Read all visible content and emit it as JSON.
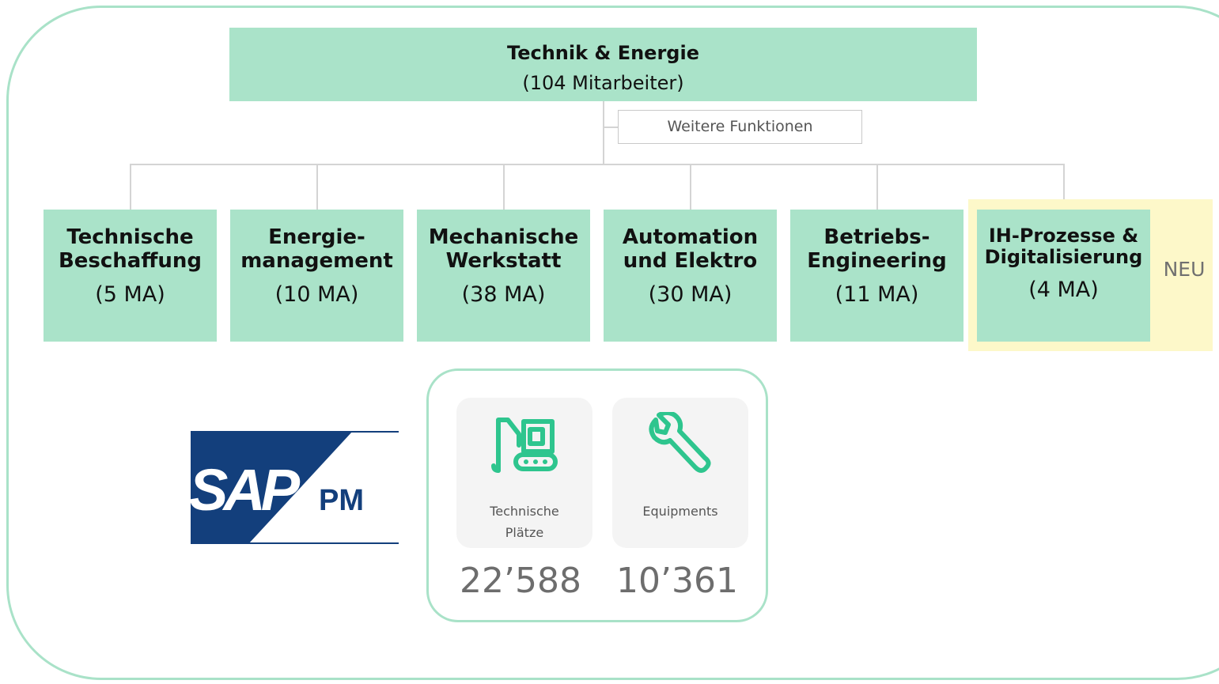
{
  "org": {
    "title": "Technik & Energie",
    "subtitle": "(104 Mitarbeiter)",
    "further_functions": "Weitere Funktionen",
    "new_label": "NEU",
    "departments": [
      {
        "name": "Technische\nBeschaffung",
        "count": "(5 MA)"
      },
      {
        "name": "Energie-\nmanagement",
        "count": "(10 MA)"
      },
      {
        "name": "Mechanische\nWerkstatt",
        "count": "(38 MA)"
      },
      {
        "name": "Automation\nund Elektro",
        "count": "(30 MA)"
      },
      {
        "name": "Betriebs-\nEngineering",
        "count": "(11 MA)"
      },
      {
        "name": "IH-Prozesse &\nDigitalisierung",
        "count": "(4 MA)"
      }
    ]
  },
  "sap": {
    "brand": "SAP",
    "module": "PM"
  },
  "stats": [
    {
      "label": "Technische\nPlätze",
      "value": "22’588",
      "icon": "crane-machinery-icon"
    },
    {
      "label": "Equipments",
      "value": "10’361",
      "icon": "wrench-icon"
    }
  ],
  "colors": {
    "box_green": "#aae3c9",
    "frame_green": "#a9e2c8",
    "highlight_yellow": "#fdf8c9",
    "icon_teal": "#2ec58e",
    "sap_blue": "#133f7c"
  }
}
